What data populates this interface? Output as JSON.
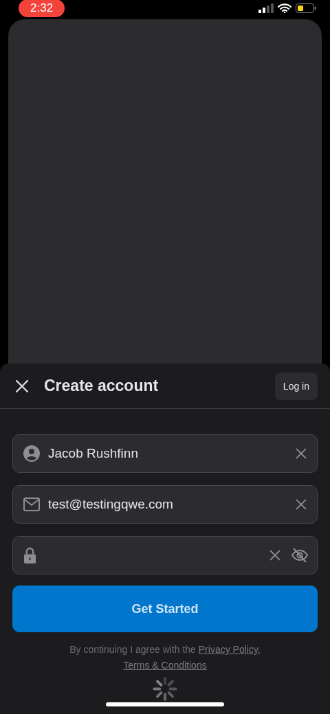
{
  "status_bar": {
    "time": "2:32"
  },
  "sheet": {
    "title": "Create account",
    "login_button": "Log in",
    "fields": [
      {
        "kind": "name",
        "value": "Jacob Rushfinn"
      },
      {
        "kind": "email",
        "value": "test@testingqwe.com"
      },
      {
        "kind": "password"
      }
    ],
    "submit_button": "Get Started",
    "legal": {
      "text": "By continuing I agree with the",
      "links": [
        "Privacy Policy,",
        "Terms & Conditions"
      ]
    },
    "loading": true
  }
}
